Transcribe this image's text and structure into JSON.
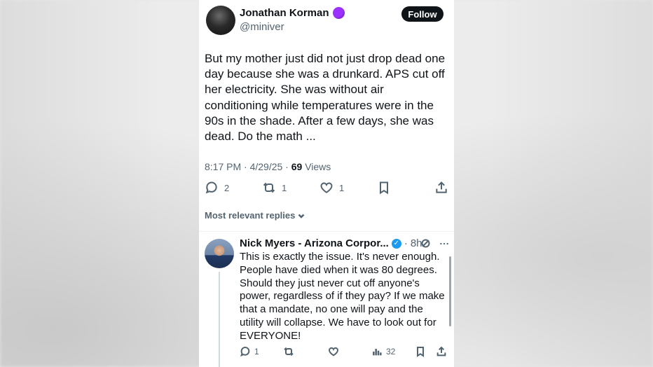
{
  "tweet": {
    "author_name": "Jonathan Korman",
    "handle": "@miniver",
    "follow_label": "Follow",
    "text": "But my mother just did not just drop dead one day because she was a drunkard. APS cut off her electricity. She was without air conditioning while temperatures were in the 90s in the shade. After a few days, she was dead. Do the math ...",
    "time": "8:17 PM · 4/29/25 · ",
    "views_count": "69",
    "views_label": " Views",
    "replies": "2",
    "reposts": "1",
    "likes": "1"
  },
  "replies_filter": {
    "label": "Most relevant replies"
  },
  "reply": {
    "author_name": "Nick Myers - Arizona Corpor...",
    "dot": "·",
    "time": "8h",
    "text": "This is exactly the issue.  It's never enough. People have died when it was 80 degrees. Should they just never cut off anyone's power, regardless of if they pay?  If we make that a mandate, no one will pay and the utility will collapse.  We have to look out for EVERYONE!",
    "replies": "1",
    "views": "32"
  },
  "colors": {
    "follow_bg": "#0f1419",
    "verified": "#1d9bf0",
    "premium_badge": "#9b30ff",
    "muted_text": "#536471"
  },
  "icons": [
    "reply-icon",
    "repost-icon",
    "like-icon",
    "bookmark-icon",
    "share-icon",
    "chevron-down-icon",
    "grok-icon",
    "more-icon",
    "views-icon",
    "verified-icon",
    "premium-badge-icon"
  ]
}
